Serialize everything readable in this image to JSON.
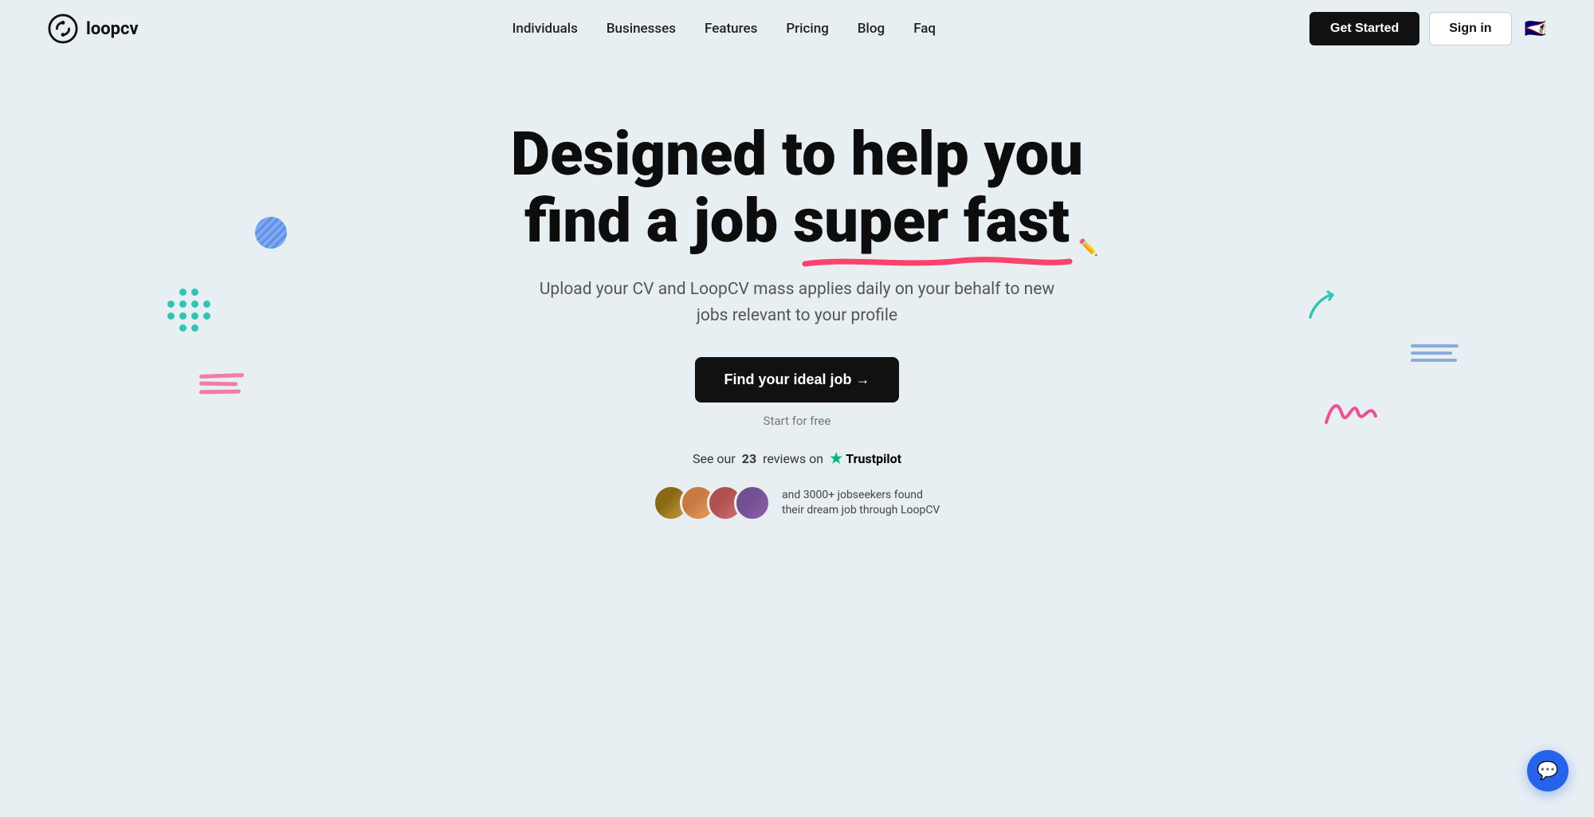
{
  "logo": {
    "text": "loopcv"
  },
  "nav": {
    "links": [
      {
        "label": "Individuals",
        "href": "#"
      },
      {
        "label": "Businesses",
        "href": "#"
      },
      {
        "label": "Features",
        "href": "#"
      },
      {
        "label": "Pricing",
        "href": "#"
      },
      {
        "label": "Blog",
        "href": "#"
      },
      {
        "label": "Faq",
        "href": "#"
      }
    ],
    "get_started": "Get Started",
    "sign_in": "Sign in"
  },
  "hero": {
    "heading_line1": "Designed to help you",
    "heading_line2": "find a job",
    "heading_line3": "super fast",
    "subtitle": "Upload your CV and LoopCV mass applies daily on your behalf to new jobs relevant to your profile",
    "cta_button": "Find your ideal job →",
    "start_free": "Start for free",
    "trustpilot_text": "See our",
    "trustpilot_count": "23",
    "trustpilot_middle": "reviews on",
    "trustpilot_name": "Trustpilot",
    "social_proof_text": "and 3000+ jobseekers found their dream job through LoopCV"
  },
  "chat": {
    "icon": "💬"
  }
}
